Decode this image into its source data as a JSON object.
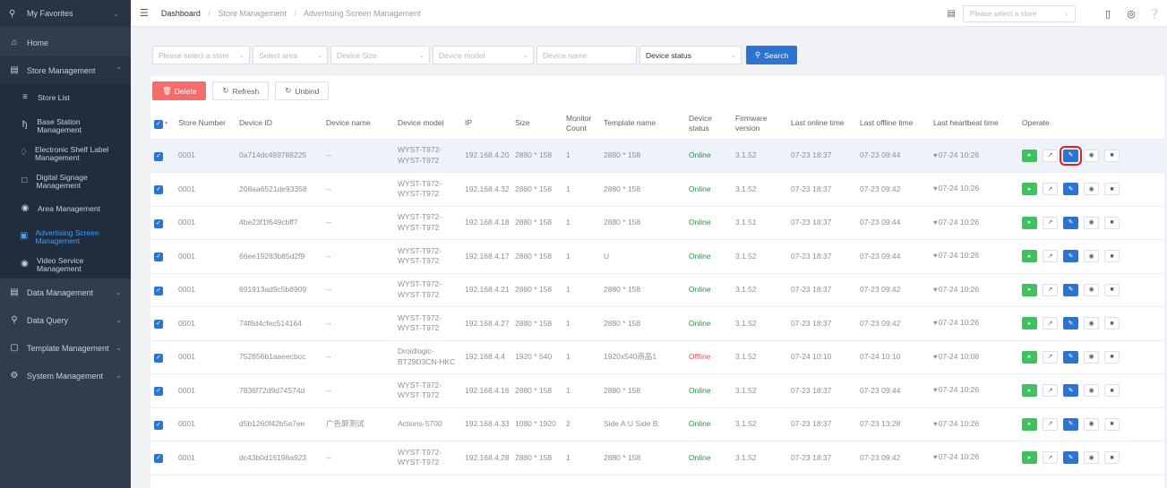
{
  "sidebar": {
    "favorites": "My Favorites",
    "home": "Home",
    "store_management": "Store Management",
    "sub_items": [
      {
        "label": "Store List",
        "icon": "list-icon"
      },
      {
        "label": "Base Station Management",
        "icon": "antenna-icon"
      },
      {
        "label": "Electronic Shelf Label Management",
        "icon": "tag-icon"
      },
      {
        "label": "Digital Signage Management",
        "icon": "monitor-icon"
      },
      {
        "label": "Area Management",
        "icon": "area-icon"
      },
      {
        "label": "Advertising Screen Management",
        "icon": "screen-icon",
        "active": true
      },
      {
        "label": "Video Service Management",
        "icon": "video-icon"
      }
    ],
    "data_management": "Data Management",
    "data_query": "Data Query",
    "template_management": "Template Management",
    "system_management": "System Management"
  },
  "header": {
    "breadcrumb": [
      "Dashboard",
      "Store Management",
      "Advertising Screen Management"
    ],
    "store_placeholder": "Please select a store"
  },
  "filters": {
    "store": "Please select a store",
    "area": "Select area",
    "size": "Device Size",
    "model": "Device model",
    "name": "Device name",
    "status": "Device status",
    "search": "Search"
  },
  "actions": {
    "delete": "Delete",
    "refresh": "Refresh",
    "unbind": "Unbind"
  },
  "table": {
    "headers": [
      "Store Number",
      "Device ID",
      "Device name",
      "Device model",
      "IP",
      "Size",
      "Monitor Count",
      "Template name",
      "Device status",
      "Firmware version",
      "Last online time",
      "Last offline time",
      "Last heartbeat time",
      "Operate"
    ],
    "rows": [
      {
        "store": "0001",
        "id": "0a714dc489788225",
        "name": "--",
        "model": "WYST-T972-WYST-T972",
        "ip": "192.168.4.20",
        "size": "2880 * 158",
        "count": "1",
        "template": "2880 * 158",
        "status": "Online",
        "fw": "3.1.52",
        "online": "07-23 18:37",
        "offline": "07-23 09:44",
        "heartbeat": "07-24 10:26"
      },
      {
        "store": "0001",
        "id": "208aa6521de93358",
        "name": "--",
        "model": "WYST-T972-WYST-T972",
        "ip": "192.168.4.32",
        "size": "2880 * 158",
        "count": "1",
        "template": "2880 * 158",
        "status": "Online",
        "fw": "3.1.52",
        "online": "07-23 18:37",
        "offline": "07-23 09:42",
        "heartbeat": "07-24 10:26"
      },
      {
        "store": "0001",
        "id": "4be23f1f649cbff7",
        "name": "--",
        "model": "WYST-T972-WYST-T972",
        "ip": "192.168.4.18",
        "size": "2880 * 158",
        "count": "1",
        "template": "2880 * 158",
        "status": "Online",
        "fw": "3.1.51",
        "online": "07-23 18:37",
        "offline": "07-23 09:44",
        "heartbeat": "07-24 10:26"
      },
      {
        "store": "0001",
        "id": "66ee19283b85d2f9",
        "name": "--",
        "model": "WYST-T972-WYST-T972",
        "ip": "192.168.4.17",
        "size": "2880 * 158",
        "count": "1",
        "template": "U",
        "status": "Online",
        "fw": "3.1.52",
        "online": "07-23 18:37",
        "offline": "07-23 09:44",
        "heartbeat": "07-24 10:26"
      },
      {
        "store": "0001",
        "id": "691913ad9c5b8909",
        "name": "--",
        "model": "WYST-T972-WYST-T972",
        "ip": "192.168.4.21",
        "size": "2880 * 158",
        "count": "1",
        "template": "2880 * 158",
        "status": "Online",
        "fw": "3.1.52",
        "online": "07-23 18:37",
        "offline": "07-23 09:42",
        "heartbeat": "07-24 10:26"
      },
      {
        "store": "0001",
        "id": "74f8d4cfec514164",
        "name": "--",
        "model": "WYST-T972-WYST-T972",
        "ip": "192.168.4.27",
        "size": "2880 * 158",
        "count": "1",
        "template": "2880 * 158",
        "status": "Online",
        "fw": "3.1.52",
        "online": "07-23 18:37",
        "offline": "07-23 09:42",
        "heartbeat": "07-24 10:26"
      },
      {
        "store": "0001",
        "id": "752856b1aaeecbcc",
        "name": "--",
        "model": "Droidlogic-BT29D3CN-HKC",
        "ip": "192.168.4.4",
        "size": "1920 * 540",
        "count": "1",
        "template": "1920x540商品1",
        "status": "Offline",
        "fw": "3.1.52",
        "online": "07-24 10:10",
        "offline": "07-24 10:10",
        "heartbeat": "07-24 10:08"
      },
      {
        "store": "0001",
        "id": "7836f72d9d74574d",
        "name": "--",
        "model": "WYST-T972-WYST-T972",
        "ip": "192.168.4.16",
        "size": "2880 * 158",
        "count": "1",
        "template": "2880 * 158",
        "status": "Online",
        "fw": "3.1.52",
        "online": "07-23 18:37",
        "offline": "07-23 09:44",
        "heartbeat": "07-24 10:26"
      },
      {
        "store": "0001",
        "id": "d5b1260f42b5a7ee",
        "name": "广告屏测试",
        "model": "Actions-5700",
        "ip": "192.168.4.33",
        "size": "1080 * 1920",
        "count": "2",
        "template": "Side A:U Side B:",
        "status": "Online",
        "fw": "3.1.52",
        "online": "07-23 18:37",
        "offline": "07-23 13:28",
        "heartbeat": "07-24 10:26"
      },
      {
        "store": "0001",
        "id": "dc43b0d16198a923",
        "name": "--",
        "model": "WYST-T972-WYST-T972",
        "ip": "192.168.4.28",
        "size": "2880 * 158",
        "count": "1",
        "template": "2880 * 158",
        "status": "Online",
        "fw": "3.1.52",
        "online": "07-23 18:37",
        "offline": "07-23 09:42",
        "heartbeat": "07-24 10:26"
      }
    ]
  },
  "colors": {
    "sidebar_bg": "#2f3d4f",
    "primary": "#2d73d2",
    "online": "#1a9b3f",
    "offline": "#e05050",
    "delete": "#f56c6c",
    "op_green": "#3cc25e"
  }
}
